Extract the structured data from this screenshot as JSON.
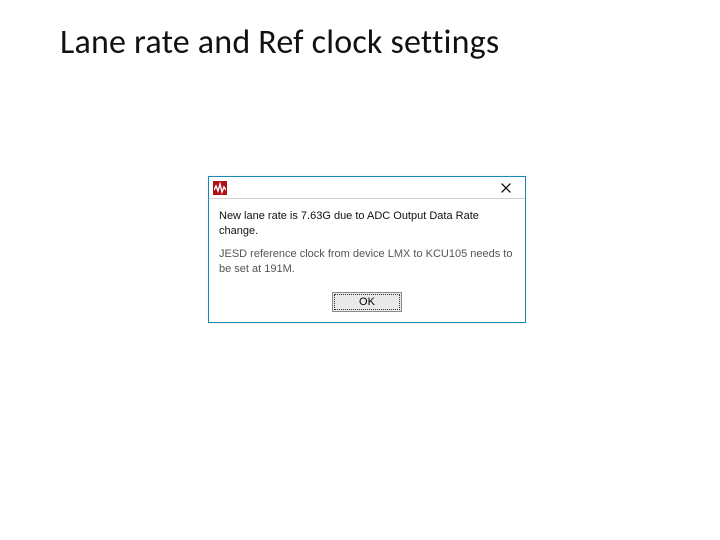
{
  "slide": {
    "title": "Lane rate and Ref clock settings"
  },
  "dialog": {
    "icon_name": "app-icon",
    "close_name": "close-icon",
    "message_primary": "New lane rate is 7.63G due to ADC Output Data Rate change.",
    "message_secondary": "JESD reference clock from device LMX to KCU105 needs to be set at 191M.",
    "ok_label": "OK"
  }
}
